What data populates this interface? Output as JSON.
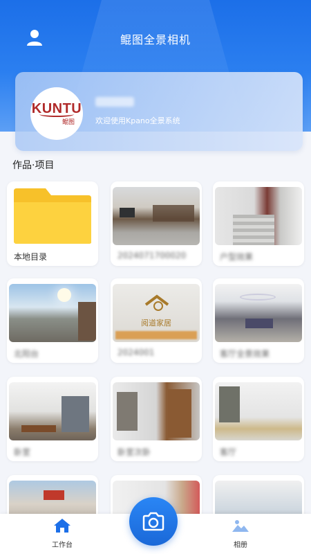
{
  "header": {
    "title": "鲲图全景相机"
  },
  "brand": {
    "logo_text": "KUNTU",
    "logo_sub": "鲲图",
    "welcome": "欢迎使用Kpano全景系统"
  },
  "projects": {
    "section_title": "作品·项目",
    "items": [
      {
        "label": "本地目录"
      },
      {
        "label": "2024071700020"
      },
      {
        "label": "户型效果"
      },
      {
        "label": "北阳台"
      },
      {
        "label": "阅道家居"
      },
      {
        "label": "客厅全景效果"
      },
      {
        "label": "卧室"
      },
      {
        "label": "卧室次卧"
      },
      {
        "label": "客厅"
      }
    ]
  },
  "tabbar": {
    "workbench_label": "工作台",
    "album_label": "相册"
  },
  "colors": {
    "primary": "#1c6fe8",
    "accent": "#2a86f5"
  }
}
